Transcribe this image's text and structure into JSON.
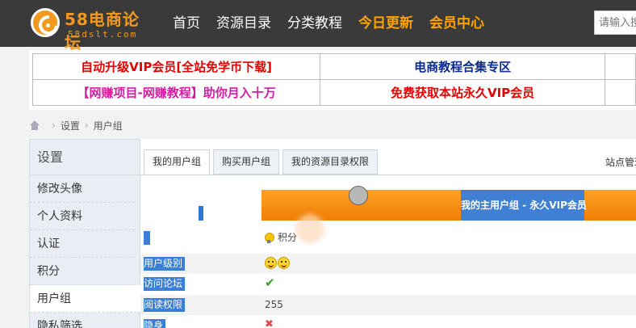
{
  "header": {
    "logo_title": "58电商论坛",
    "logo_sub": "58dslt.com",
    "nav": [
      {
        "label": "首页",
        "highlight": false
      },
      {
        "label": "资源目录",
        "highlight": false
      },
      {
        "label": "分类教程",
        "highlight": false
      },
      {
        "label": "今日更新",
        "highlight": true
      },
      {
        "label": "会员中心",
        "highlight": true
      }
    ],
    "search_placeholder": "请输入搜"
  },
  "ads": {
    "row1": [
      "自动升级VIP会员[全站免学币下载]",
      "电商教程合集专区",
      ""
    ],
    "row2": [
      "【网赚项目-网赚教程】助你月入十万",
      "免费获取本站永久VIP会员",
      ""
    ]
  },
  "breadcrumb": [
    "设置",
    "用户组"
  ],
  "sidebar": {
    "title": "设置",
    "items": [
      "修改头像",
      "个人资料",
      "认证",
      "积分",
      "用户组",
      "隐私筛选"
    ],
    "active_index": 4
  },
  "tabs": [
    "我的用户组",
    "购买用户组",
    "我的资源目录权限"
  ],
  "site_manager": "站点管理",
  "progress": {
    "label": "我的主用户组 - 永久VIP会员"
  },
  "rows": [
    {
      "label": "",
      "value": "积分"
    },
    {
      "label": "用户级别",
      "value": ""
    },
    {
      "label": "访问论坛",
      "value": ""
    },
    {
      "label": "阅读权限",
      "value": "255"
    },
    {
      "label": "隐身",
      "value": ""
    }
  ],
  "colors": {
    "header_bg": "#3a3a3a",
    "brand_orange": "#f39a1e",
    "nav_highlight": "#ffa300",
    "progress_orange": "#f07e05",
    "progress_blue": "#3f7fd4",
    "label_blue": "#3a7fd6"
  }
}
